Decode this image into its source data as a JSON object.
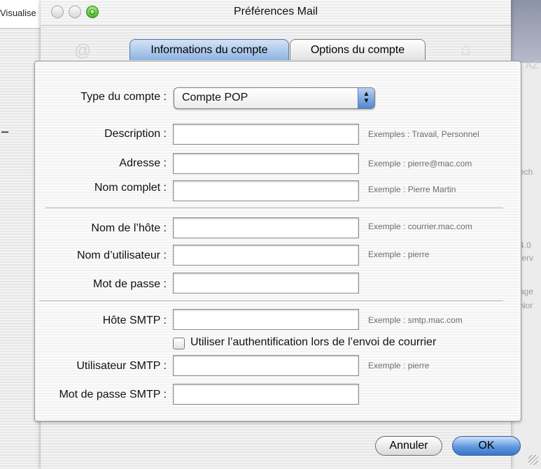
{
  "background_app": {
    "left_label": "Visualise",
    "right_texts": [
      "AZ",
      "ech",
      "4.0",
      "terv",
      "age",
      "Nor"
    ]
  },
  "window": {
    "title": "Préférences Mail",
    "tabs": [
      {
        "label": "Informations du compte",
        "selected": true
      },
      {
        "label": "Options du compte",
        "selected": false
      }
    ]
  },
  "form": {
    "account_type": {
      "label": "Type du compte :",
      "value": "Compte POP"
    },
    "description": {
      "label": "Description :",
      "value": "",
      "hint": "Exemples : Travail, Personnel"
    },
    "address": {
      "label": "Adresse :",
      "value": "",
      "hint": "Exemple : pierre@mac.com"
    },
    "full_name": {
      "label": "Nom complet :",
      "value": "",
      "hint": "Exemple : Pierre Martin"
    },
    "host_name": {
      "label": "Nom de l’hôte :",
      "value": "",
      "hint": "Exemple : courrier.mac.com"
    },
    "user_name": {
      "label": "Nom d’utilisateur :",
      "value": "",
      "hint": "Exemple : pierre"
    },
    "password": {
      "label": "Mot de passe :",
      "value": ""
    },
    "smtp_host": {
      "label": "Hôte SMTP :",
      "value": "",
      "hint": "Exemple : smtp.mac.com"
    },
    "smtp_auth": {
      "label": "Utiliser l’authentification lors de l’envoi de courrier",
      "checked": false
    },
    "smtp_user": {
      "label": "Utilisateur SMTP :",
      "value": "",
      "hint": "Exemple : pierre"
    },
    "smtp_password": {
      "label": "Mot de passe SMTP :",
      "value": ""
    }
  },
  "buttons": {
    "cancel": "Annuler",
    "ok": "OK"
  },
  "colors": {
    "accent": "#5f97df",
    "zoom_button": "#5cc23a"
  }
}
